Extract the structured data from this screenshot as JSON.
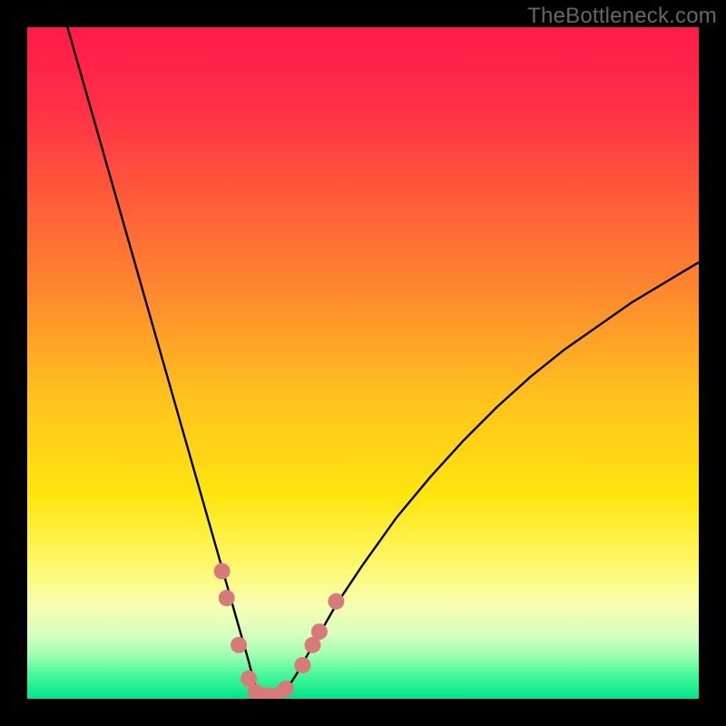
{
  "watermark": "TheBottleneck.com",
  "chart_data": {
    "type": "line",
    "title": "",
    "xlabel": "",
    "ylabel": "",
    "xlim": [
      0,
      100
    ],
    "ylim": [
      0,
      100
    ],
    "background": {
      "type": "vertical-gradient",
      "stops": [
        {
          "offset": 0.0,
          "color": "#ff1a4a"
        },
        {
          "offset": 0.12,
          "color": "#ff3046"
        },
        {
          "offset": 0.25,
          "color": "#ff5a3a"
        },
        {
          "offset": 0.4,
          "color": "#ff8a2e"
        },
        {
          "offset": 0.55,
          "color": "#ffc21e"
        },
        {
          "offset": 0.7,
          "color": "#ffe60f"
        },
        {
          "offset": 0.8,
          "color": "#fff76a"
        },
        {
          "offset": 0.86,
          "color": "#f7ffb0"
        },
        {
          "offset": 0.905,
          "color": "#d6ffc0"
        },
        {
          "offset": 0.935,
          "color": "#9effb0"
        },
        {
          "offset": 0.965,
          "color": "#46f79a"
        },
        {
          "offset": 1.0,
          "color": "#00e58a"
        }
      ]
    },
    "series": [
      {
        "name": "bottleneck-curve",
        "color": "#000000",
        "x": [
          6,
          8,
          10,
          12,
          14,
          16,
          18,
          20,
          22,
          24,
          26,
          27,
          28,
          29,
          30,
          31,
          32,
          33,
          33.5,
          34,
          35,
          36,
          37,
          38,
          39,
          40,
          42,
          44,
          46,
          50,
          55,
          60,
          65,
          70,
          75,
          80,
          85,
          90,
          95,
          100
        ],
        "y": [
          100,
          93,
          86,
          79,
          72,
          65,
          58,
          51,
          44,
          37,
          30,
          26.5,
          23,
          19.5,
          16,
          12.5,
          9,
          5.5,
          3.5,
          2,
          1,
          0.5,
          0.5,
          1,
          2,
          3.5,
          7,
          10.5,
          14,
          20,
          27,
          33,
          38.5,
          43.5,
          48,
          52,
          55.5,
          59,
          62,
          65
        ]
      }
    ],
    "markers": {
      "name": "sample-points",
      "color": "#d97a7a",
      "radius_px": 9,
      "points": [
        {
          "x": 29.0,
          "y": 19.0
        },
        {
          "x": 29.7,
          "y": 15.0
        },
        {
          "x": 31.5,
          "y": 8.0
        },
        {
          "x": 33.0,
          "y": 3.0
        },
        {
          "x": 34.0,
          "y": 1.0
        },
        {
          "x": 35.0,
          "y": 0.5
        },
        {
          "x": 36.0,
          "y": 0.5
        },
        {
          "x": 37.0,
          "y": 0.5
        },
        {
          "x": 38.5,
          "y": 1.5
        },
        {
          "x": 41.0,
          "y": 5.0
        },
        {
          "x": 42.5,
          "y": 8.0
        },
        {
          "x": 43.5,
          "y": 10.0
        },
        {
          "x": 46.0,
          "y": 14.5
        }
      ]
    }
  }
}
